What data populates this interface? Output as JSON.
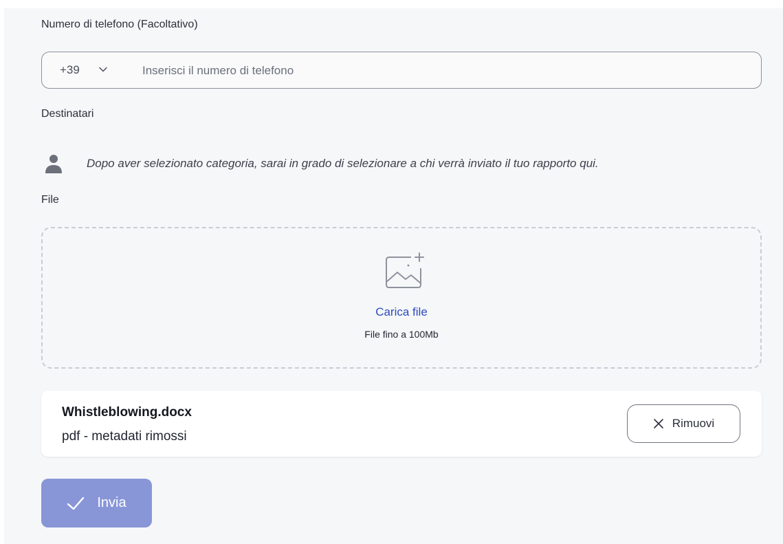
{
  "phone": {
    "label": "Numero di telefono (Facoltativo)",
    "prefix": "+39",
    "placeholder": "Inserisci il numero di telefono",
    "value": ""
  },
  "recipients": {
    "label": "Destinatari",
    "note": "Dopo aver selezionato categoria, sarai in grado di selezionare a chi verrà inviato il tuo rapporto qui."
  },
  "file": {
    "label": "File",
    "upload_label": "Carica file",
    "upload_hint": "File fino a 100Mb",
    "attached": {
      "name": "Whistleblowing.docx",
      "meta": "pdf - metadati rimossi"
    },
    "remove_label": "Rimuovi"
  },
  "submit": {
    "label": "Invia"
  },
  "colors": {
    "accent": "#8896d8",
    "link": "#2c4bbf",
    "background": "#f6f7f9"
  },
  "icons": [
    "chevron-down-icon",
    "person-icon",
    "image-upload-icon",
    "close-icon",
    "check-icon"
  ]
}
